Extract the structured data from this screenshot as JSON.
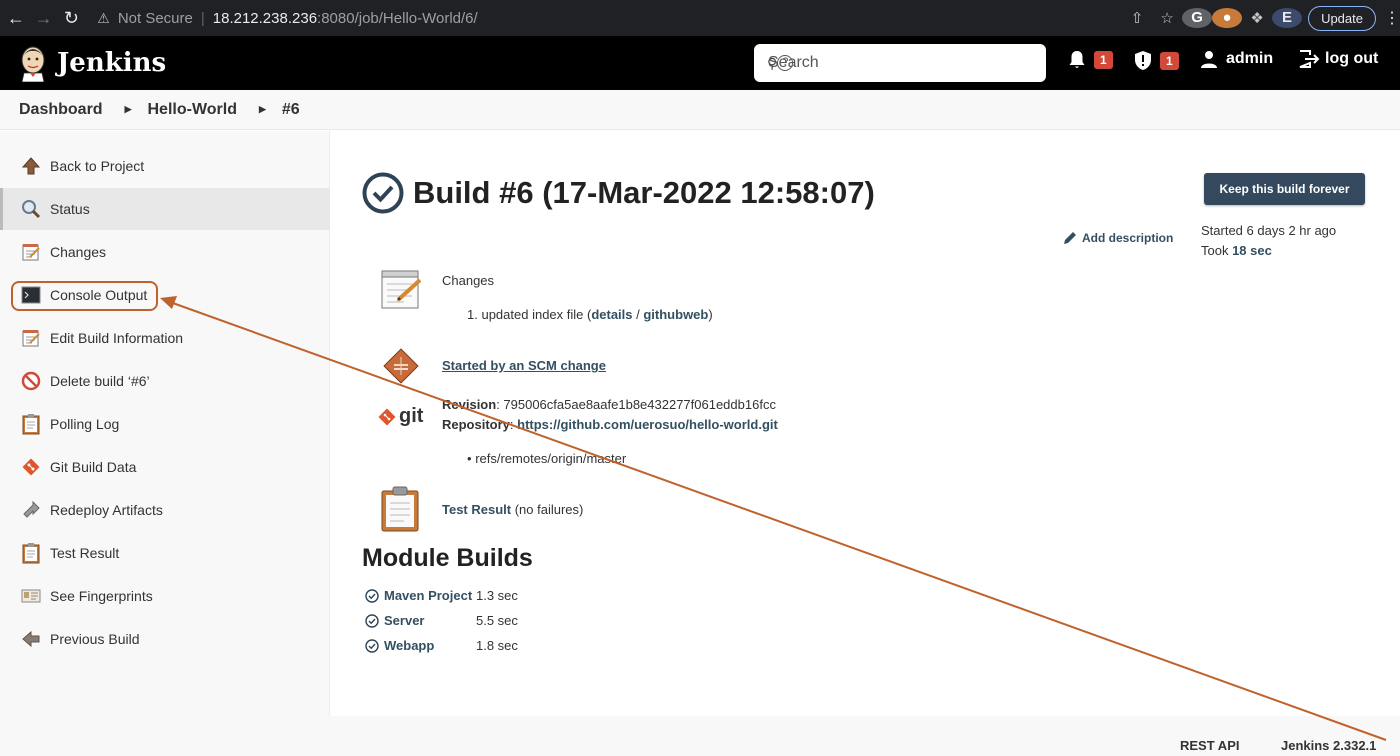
{
  "browser": {
    "security": "Not Secure",
    "url_host": "18.212.238.236",
    "url_path": ":8080/job/Hello-World/6/",
    "update_label": "Update",
    "profile_initial": "E"
  },
  "header": {
    "brand": "Jenkins",
    "search_placeholder": "Search",
    "notifications_count": "1",
    "security_count": "1",
    "user": "admin",
    "logout": "log out"
  },
  "breadcrumb": [
    "Dashboard",
    "Hello-World",
    "#6"
  ],
  "sidebar": {
    "items": [
      {
        "label": "Back to Project",
        "icon": "up-arrow-icon"
      },
      {
        "label": "Status",
        "icon": "magnifier-icon"
      },
      {
        "label": "Changes",
        "icon": "notepad-icon"
      },
      {
        "label": "Console Output",
        "icon": "terminal-icon"
      },
      {
        "label": "Edit Build Information",
        "icon": "notepad-icon"
      },
      {
        "label": "Delete build ‘#6’",
        "icon": "no-entry-icon"
      },
      {
        "label": "Polling Log",
        "icon": "clipboard-icon"
      },
      {
        "label": "Git Build Data",
        "icon": "git-icon"
      },
      {
        "label": "Redeploy Artifacts",
        "icon": "redeploy-icon"
      },
      {
        "label": "Test Result",
        "icon": "clipboard-icon"
      },
      {
        "label": "See Fingerprints",
        "icon": "fingerprint-icon"
      },
      {
        "label": "Previous Build",
        "icon": "left-arrow-icon"
      }
    ]
  },
  "build": {
    "title": "Build #6 (17-Mar-2022 12:58:07)",
    "keep_forever": "Keep this build forever",
    "add_description": "Add description",
    "started": "Started 6 days 2 hr ago",
    "took_prefix": "Took ",
    "took_value": "18 sec"
  },
  "changes": {
    "heading": "Changes",
    "item_number": "1.",
    "item_text": "updated index file (",
    "details": "details",
    "slash": " / ",
    "githubweb": "githubweb",
    "close": ")"
  },
  "cause": {
    "label": "Started by an SCM change"
  },
  "git": {
    "logo_text": "git",
    "revision_label": "Revision",
    "revision": ": 795006cfa5ae8aafe1b8e432277f061eddb16fcc",
    "repository_label": "Repository",
    "repository_sep": ": ",
    "repository": "https://github.com/uerosuo/hello-world.git",
    "branch": "refs/remotes/origin/master"
  },
  "test_result": {
    "label": "Test Result",
    "suffix": " (no failures)"
  },
  "module_builds": {
    "heading": "Module Builds",
    "rows": [
      {
        "name": "Maven Project",
        "time": "1.3 sec"
      },
      {
        "name": "Server",
        "time": "5.5 sec"
      },
      {
        "name": "Webapp",
        "time": "1.8 sec"
      }
    ]
  },
  "footer": {
    "rest_api": "REST API",
    "version": "Jenkins 2.332.1"
  },
  "colors": {
    "annotation": "#c0622b",
    "header_bg": "#000000",
    "badge": "#d24939",
    "button": "#34495e",
    "link": "#335061"
  }
}
